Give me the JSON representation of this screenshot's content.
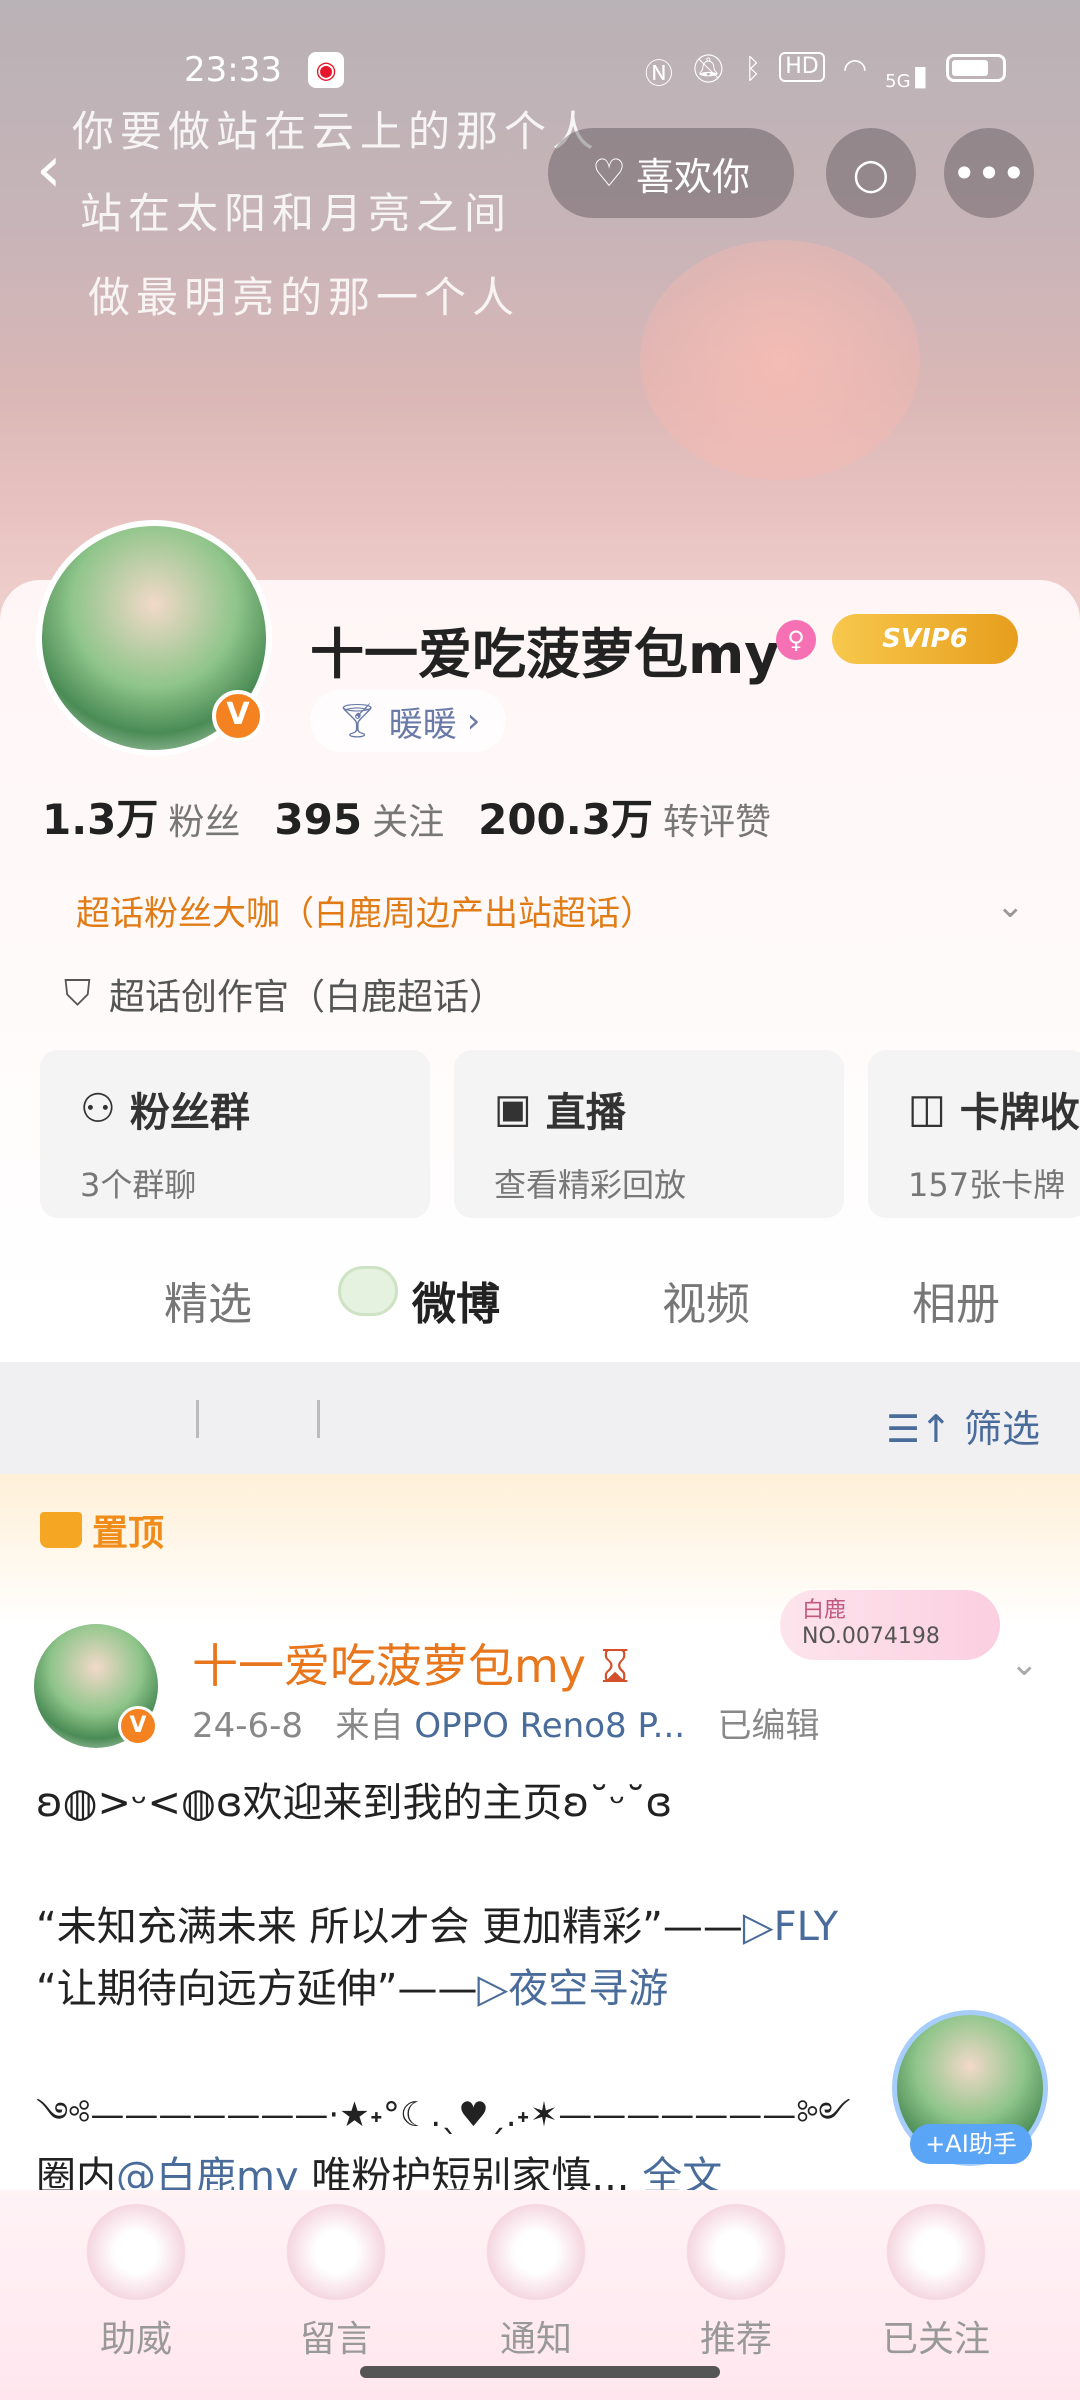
{
  "status_bar": {
    "time": "23:33",
    "icons": [
      "nfc-icon",
      "mute-icon",
      "bluetooth-icon",
      "hd-icon",
      "wifi-icon",
      "5g-signal-icon",
      "battery-icon"
    ],
    "hd_label": "HD",
    "network_label": "5G"
  },
  "header": {
    "handwriting": [
      "你要做站在云上的那个人",
      "站在太阳和月亮之间",
      "做最明亮的那一个人"
    ],
    "like_button": "喜欢你"
  },
  "profile": {
    "name": "十一爱吃菠萝包my",
    "vip_badge": "SVIP6",
    "verified": "V",
    "tag": "暖暖",
    "stats": [
      {
        "value": "1.3万",
        "label": "粉丝"
      },
      {
        "value": "395",
        "label": "关注"
      },
      {
        "value": "200.3万",
        "label": "转评赞"
      }
    ],
    "superfan": "超话粉丝大咖（白鹿周边产出站超话）",
    "creator": "超话创作官（白鹿超话）"
  },
  "tiles": [
    {
      "title": "粉丝群",
      "sub": "3个群聊",
      "icon": "group-icon"
    },
    {
      "title": "直播",
      "sub": "查看精彩回放",
      "icon": "tv-icon"
    },
    {
      "title": "卡牌收",
      "sub": "157张卡牌",
      "icon": "card-icon"
    }
  ],
  "tabs": [
    "精选",
    "微博",
    "视频",
    "相册"
  ],
  "filter": "筛选",
  "pinned_label": "置顶",
  "post": {
    "author": "十一爱吃菠萝包my",
    "date": "24-6-8",
    "source_prefix": "来自",
    "source": "OPPO Reno8 P...",
    "edited": "已编辑",
    "bailu_badge": "白鹿",
    "bailu_no": "NO.0074198",
    "line1": "ʚ◍>ᵕ<◍ɞ欢迎来到我的主页ʚ˘ᵕ˘ɞ",
    "line2_text": "“未知充满未来 所以才会 更加精彩”——",
    "line2_link": "▷FLY",
    "line3_text": "“让期待向远方延伸”——",
    "line3_link": "▷夜空寻游",
    "line4": "༺———————·★˖°☾.ˎ♥ˏ.˖✶———————༻",
    "line5_prefix": "圈内",
    "line5_mention": "@白鹿my",
    "line5_text": " 唯粉护短别家慎...",
    "line5_more": "全文"
  },
  "ai_assistant": "+AI助手",
  "bottom_nav": [
    "助威",
    "留言",
    "通知",
    "推荐",
    "已关注"
  ]
}
